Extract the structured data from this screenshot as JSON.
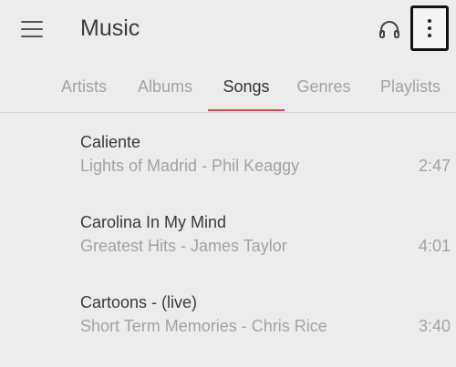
{
  "appbar": {
    "title": "Music",
    "icons": {
      "menu": "hamburger-menu-icon",
      "headphones": "headphones-icon",
      "more": "more-vertical-icon"
    }
  },
  "tabs": [
    {
      "label": "Artists",
      "active": false
    },
    {
      "label": "Albums",
      "active": false
    },
    {
      "label": "Songs",
      "active": true
    },
    {
      "label": "Genres",
      "active": false
    },
    {
      "label": "Playlists",
      "active": false
    }
  ],
  "songs": [
    {
      "title": "Caliente",
      "subtitle": "Lights of Madrid - Phil Keaggy",
      "duration": "2:47"
    },
    {
      "title": "Carolina In My Mind",
      "subtitle": "Greatest Hits - James Taylor",
      "duration": "4:01"
    },
    {
      "title": "Cartoons - (live)",
      "subtitle": "Short Term Memories - Chris Rice",
      "duration": "3:40"
    }
  ],
  "colors": {
    "background": "#ececec",
    "accent": "#d9474c",
    "primary_text": "#3a3a3a",
    "secondary_text": "#a3a3a3"
  }
}
